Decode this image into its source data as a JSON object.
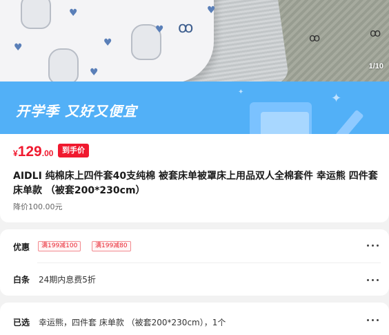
{
  "gallery": {
    "counter": "1/10"
  },
  "banner": {
    "slogan": "开学季 又好又便宜"
  },
  "price": {
    "currency": "¥",
    "integer": "129",
    "decimal": ".00",
    "badge": "到手价"
  },
  "product": {
    "title": "AIDLI 纯棉床上四件套40支纯棉 被套床单被罩床上用品双人全棉套件 幸运熊 四件套 床单款 （被套200*230cm）",
    "price_drop": "降价100.00元"
  },
  "offers": {
    "label": "优惠",
    "coupons": [
      "满199减100",
      "满199减80"
    ]
  },
  "installment": {
    "label": "白条",
    "text": "24期内息费5折"
  },
  "selected": {
    "label": "已选",
    "text": "幸运熊，四件套 床单款 （被套200*230cm），1个"
  },
  "icons": {
    "more": "more-dots-icon"
  },
  "colors": {
    "accent": "#f0192f",
    "banner": "#52b0f7"
  }
}
